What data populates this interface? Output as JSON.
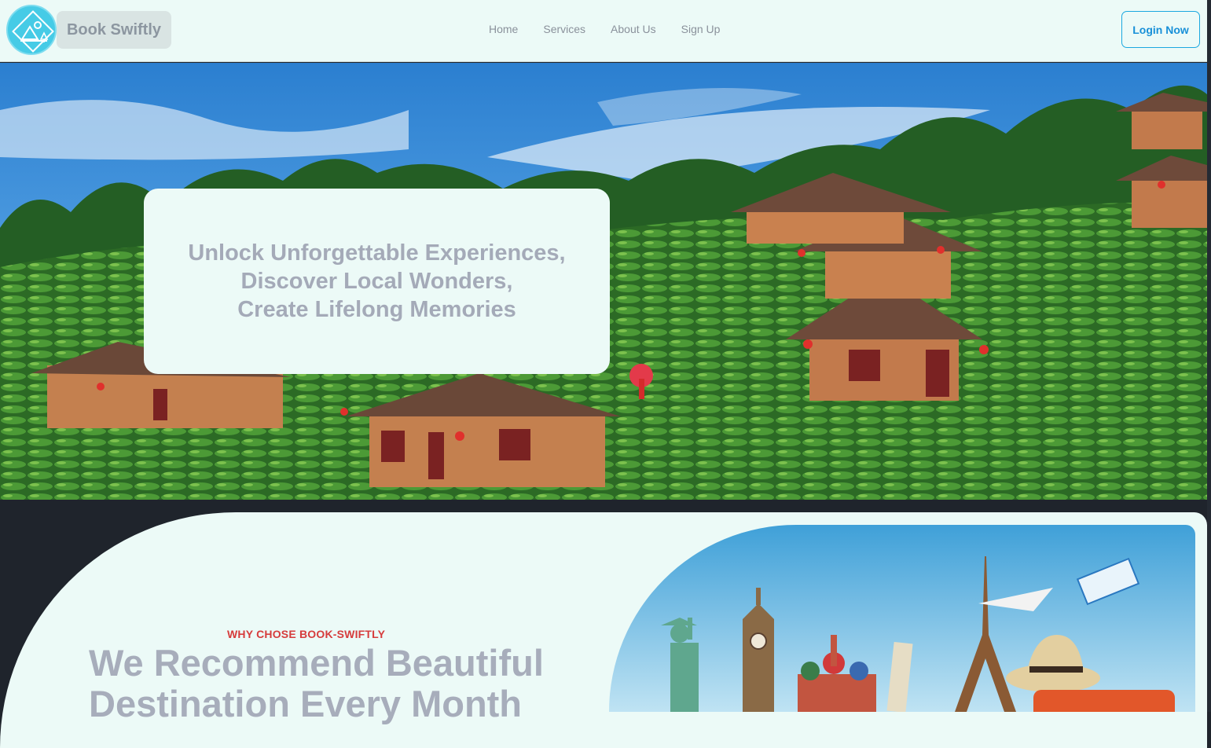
{
  "header": {
    "brand": "Book Swiftly",
    "logo_icon": "mountain-camp-icon",
    "nav": [
      {
        "label": "Home"
      },
      {
        "label": "Services"
      },
      {
        "label": "About Us"
      },
      {
        "label": "Sign Up"
      }
    ],
    "login_label": "Login Now"
  },
  "hero": {
    "image": "tea-plantation-village-photo",
    "lines": [
      "Unlock Unforgettable Experiences,",
      "Discover Local Wonders,",
      "Create Lifelong Memories"
    ]
  },
  "recommend": {
    "eyebrow": "WHY CHOSE BOOK-SWIFTLY",
    "headline_lines": [
      "We Recommend Beautiful",
      "Destination Every Month"
    ],
    "image": "world-landmarks-travel-photo"
  },
  "colors": {
    "header_bg": "#ecfaf7",
    "accent": "#1ba8e0",
    "eyebrow_red": "#d63c3c",
    "dark_bg": "#1f242c"
  }
}
